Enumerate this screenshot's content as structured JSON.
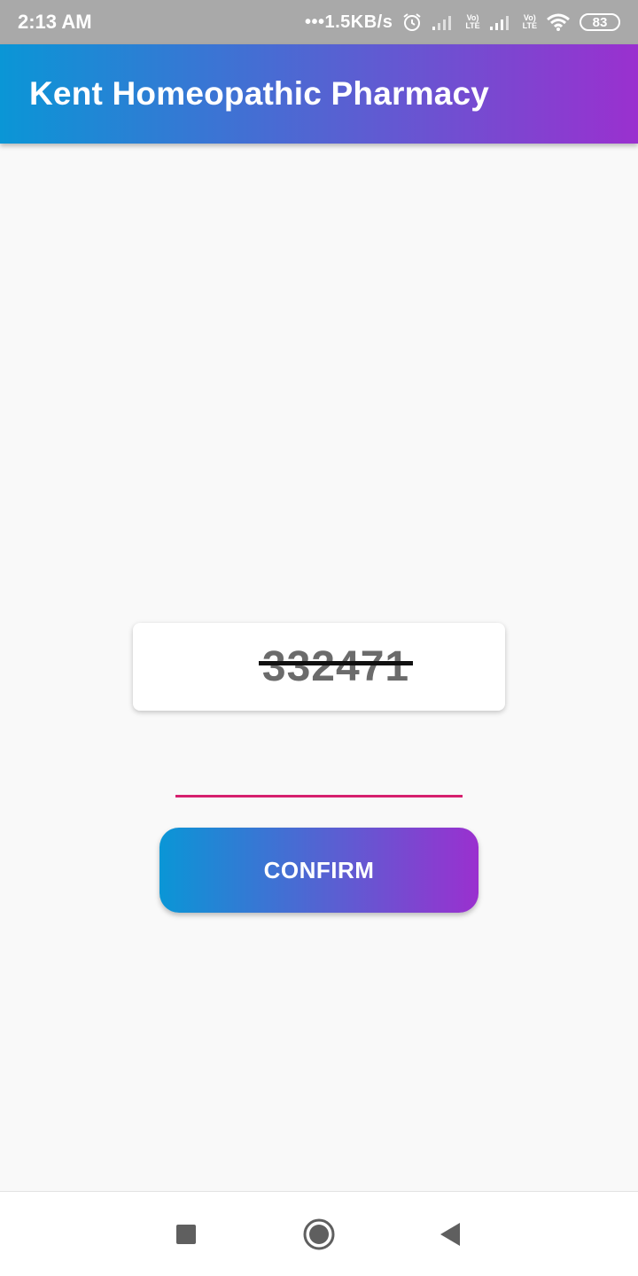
{
  "status_bar": {
    "time": "2:13 AM",
    "net_speed": "•••1.5KB/s",
    "volte_1": "Vo\nLTE",
    "volte_2": "Vo\nLTE",
    "battery": "83",
    "icons": [
      "alarm-icon",
      "signal-icon",
      "volte-icon",
      "signal-icon",
      "volte-icon",
      "wifi-icon",
      "battery-icon"
    ]
  },
  "app_bar": {
    "title": "Kent Homeopathic Pharmacy",
    "gradient": [
      "#0a96d6",
      "#5a5fd2",
      "#9a30cf"
    ]
  },
  "captcha": {
    "code": "332471"
  },
  "code_input": {
    "value": "",
    "underline_color": "#d6206e"
  },
  "confirm_button": {
    "label": "CONFIRM"
  },
  "nav_bar": {
    "icons": [
      "recents-square-icon",
      "home-circle-icon",
      "back-triangle-icon"
    ]
  }
}
